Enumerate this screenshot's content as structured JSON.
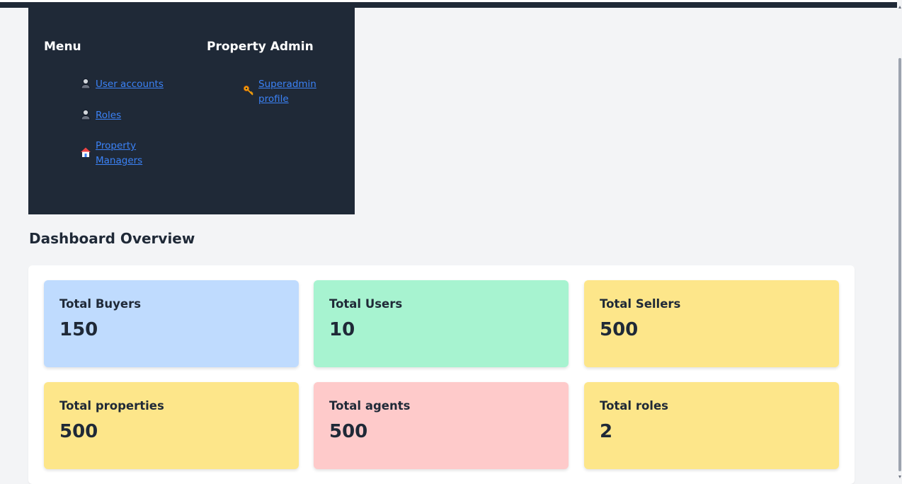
{
  "sidebar": {
    "menu": {
      "heading": "Menu",
      "items": [
        {
          "label": "User accounts",
          "icon": "user-icon"
        },
        {
          "label": "Roles",
          "icon": "user-icon"
        },
        {
          "label": "Property Managers",
          "icon": "house-icon"
        }
      ]
    },
    "property_admin": {
      "heading": "Property Admin",
      "items": [
        {
          "label": "Superadmin profile",
          "icon": "key-icon"
        }
      ]
    }
  },
  "main": {
    "title": "Dashboard Overview",
    "stats": [
      {
        "label": "Total Buyers",
        "value": "150",
        "color": "#bfdbfe"
      },
      {
        "label": "Total Users",
        "value": "10",
        "color": "#a7f3d0"
      },
      {
        "label": "Total Sellers",
        "value": "500",
        "color": "#fde68a"
      },
      {
        "label": "Total properties",
        "value": "500",
        "color": "#fde68a"
      },
      {
        "label": "Total agents",
        "value": "500",
        "color": "#fecaca"
      },
      {
        "label": "Total roles",
        "value": "2",
        "color": "#fde68a"
      }
    ]
  },
  "colors": {
    "sidebar_bg": "#1f2937",
    "link": "#3b82f6",
    "page_bg": "#f3f4f6"
  }
}
